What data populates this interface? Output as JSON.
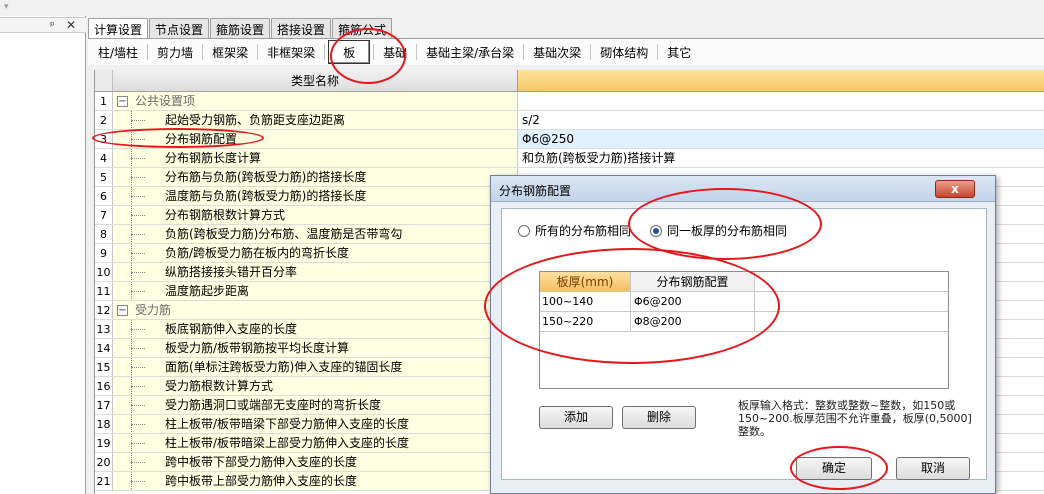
{
  "left_panel": {
    "pin_icon": "pin-icon",
    "close_icon": "close-icon"
  },
  "main_tabs": [
    "计算设置",
    "节点设置",
    "箍筋设置",
    "搭接设置",
    "箍筋公式"
  ],
  "sub_tabs": [
    "柱/墙柱",
    "剪力墙",
    "框架梁",
    "非框架梁",
    "板",
    "基础",
    "基础主梁/承台梁",
    "基础次梁",
    "砌体结构",
    "其它"
  ],
  "grid": {
    "header_name": "类型名称",
    "rows": [
      {
        "num": "1",
        "name": "公共设置项",
        "value": "",
        "group": true
      },
      {
        "num": "2",
        "name": "起始受力钢筋、负筋距支座边距离",
        "value": "s/2"
      },
      {
        "num": "3",
        "name": "分布钢筋配置",
        "value": "Φ6@250",
        "selected": true
      },
      {
        "num": "4",
        "name": "分布钢筋长度计算",
        "value": "和负筋(跨板受力筋)搭接计算"
      },
      {
        "num": "5",
        "name": "分布筋与负筋(跨板受力筋)的搭接长度",
        "value": ""
      },
      {
        "num": "6",
        "name": "温度筋与负筋(跨板受力筋)的搭接长度",
        "value": ""
      },
      {
        "num": "7",
        "name": "分布钢筋根数计算方式",
        "value": ""
      },
      {
        "num": "8",
        "name": "负筋(跨板受力筋)分布筋、温度筋是否带弯勾",
        "value": ""
      },
      {
        "num": "9",
        "name": "负筋/跨板受力筋在板内的弯折长度",
        "value": ""
      },
      {
        "num": "10",
        "name": "纵筋搭接接头错开百分率",
        "value": ""
      },
      {
        "num": "11",
        "name": "温度筋起步距离",
        "value": ""
      },
      {
        "num": "12",
        "name": "受力筋",
        "value": "",
        "group": true
      },
      {
        "num": "13",
        "name": "板底钢筋伸入支座的长度",
        "value": ""
      },
      {
        "num": "14",
        "name": "板受力筋/板带钢筋按平均长度计算",
        "value": ""
      },
      {
        "num": "15",
        "name": "面筋(单标注跨板受力筋)伸入支座的锚固长度",
        "value": ""
      },
      {
        "num": "16",
        "name": "受力筋根数计算方式",
        "value": ""
      },
      {
        "num": "17",
        "name": "受力筋遇洞口或端部无支座时的弯折长度",
        "value": ""
      },
      {
        "num": "18",
        "name": "柱上板带/板带暗梁下部受力筋伸入支座的长度",
        "value": ""
      },
      {
        "num": "19",
        "name": "柱上板带/板带暗梁上部受力筋伸入支座的长度",
        "value": ""
      },
      {
        "num": "20",
        "name": "跨中板带下部受力筋伸入支座的长度",
        "value": ""
      },
      {
        "num": "21",
        "name": "跨中板带上部受力筋伸入支座的长度",
        "value": ""
      }
    ]
  },
  "dialog": {
    "title": "分布钢筋配置",
    "close_label": "x",
    "radio_all": "所有的分布筋相同",
    "radio_same_thickness": "同一板厚的分布筋相同",
    "table_headers": [
      "板厚(mm)",
      "分布钢筋配置"
    ],
    "table_rows": [
      [
        "100~140",
        "Φ6@200"
      ],
      [
        "150~220",
        "Φ8@200"
      ]
    ],
    "add_label": "添加",
    "delete_label": "删除",
    "hint": "板厚输入格式：整数或整数~整数，如150或150~200.板厚范围不允许重叠，板厚(0,5000]整数。",
    "ok_label": "确定",
    "cancel_label": "取消"
  },
  "colors": {
    "annotation": "#e8151b",
    "header_value": "#f6c868",
    "name_cell": "#ffffe1"
  }
}
